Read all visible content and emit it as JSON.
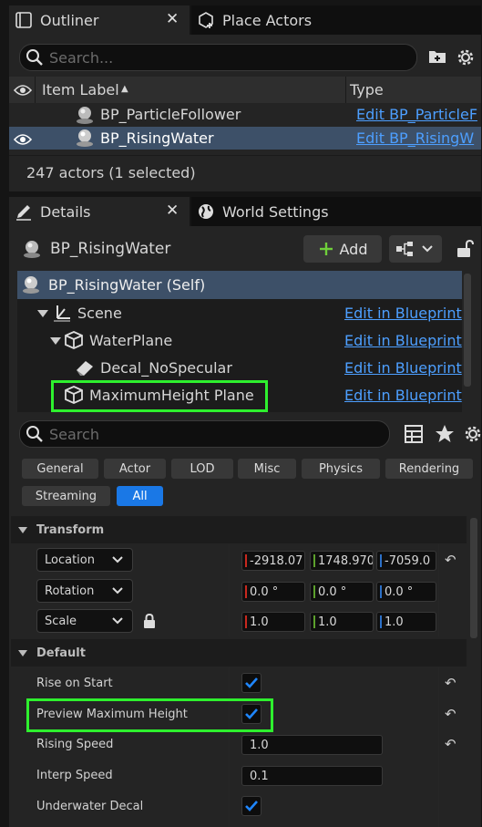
{
  "outliner": {
    "tab_label": "Outliner",
    "tab2_label": "Place Actors",
    "search_placeholder": "Search...",
    "col_item_label": "Item Label",
    "sort_indicator": "▲",
    "col_type": "Type",
    "rows": [
      {
        "label": "BP_ParticleFollower",
        "type": "Edit BP_ParticleF"
      },
      {
        "label": "BP_RisingWater",
        "type": "Edit BP_RisingW"
      }
    ],
    "status": "247 actors (1 selected)"
  },
  "details": {
    "tab_label": "Details",
    "tab2_label": "World Settings",
    "actor_name": "BP_RisingWater",
    "add_label": "Add",
    "components": [
      {
        "label": "BP_RisingWater (Self)",
        "link": ""
      },
      {
        "label": "Scene",
        "link": "Edit in Blueprint"
      },
      {
        "label": "WaterPlane",
        "link": "Edit in Blueprint"
      },
      {
        "label": "Decal_NoSpecular",
        "link": "Edit in Blueprint"
      },
      {
        "label": "MaximumHeight Plane",
        "link": "Edit in Blueprint"
      }
    ],
    "search_placeholder": "Search",
    "filters": [
      "General",
      "Actor",
      "LOD",
      "Misc",
      "Physics",
      "Rendering",
      "Streaming",
      "All"
    ],
    "selected_filter": "All",
    "transform": {
      "title": "Transform",
      "location_label": "Location",
      "rotation_label": "Rotation",
      "scale_label": "Scale",
      "location": [
        "-2918.07",
        "1748.970",
        "-7059.0"
      ],
      "rotation": [
        "0.0 °",
        "0.0 °",
        "0.0 °"
      ],
      "scale": [
        "1.0",
        "1.0",
        "1.0"
      ]
    },
    "default": {
      "title": "Default",
      "rise_on_start_label": "Rise on Start",
      "rise_on_start": true,
      "preview_max_label": "Preview Maximum Height",
      "preview_max": true,
      "rising_speed_label": "Rising Speed",
      "rising_speed": "1.0",
      "interp_speed_label": "Interp Speed",
      "interp_speed": "0.1",
      "underwater_decal_label": "Underwater Decal",
      "underwater_decal": true
    }
  },
  "colors": {
    "link": "#4d9fff",
    "selected_row": "#3d5068",
    "selected_filter": "#1a78e6",
    "highlight": "#2ef02e",
    "x_axis": "#c8281e",
    "y_axis": "#5ca02c",
    "z_axis": "#2c70c8",
    "checkbox_check": "#1f86ff"
  }
}
